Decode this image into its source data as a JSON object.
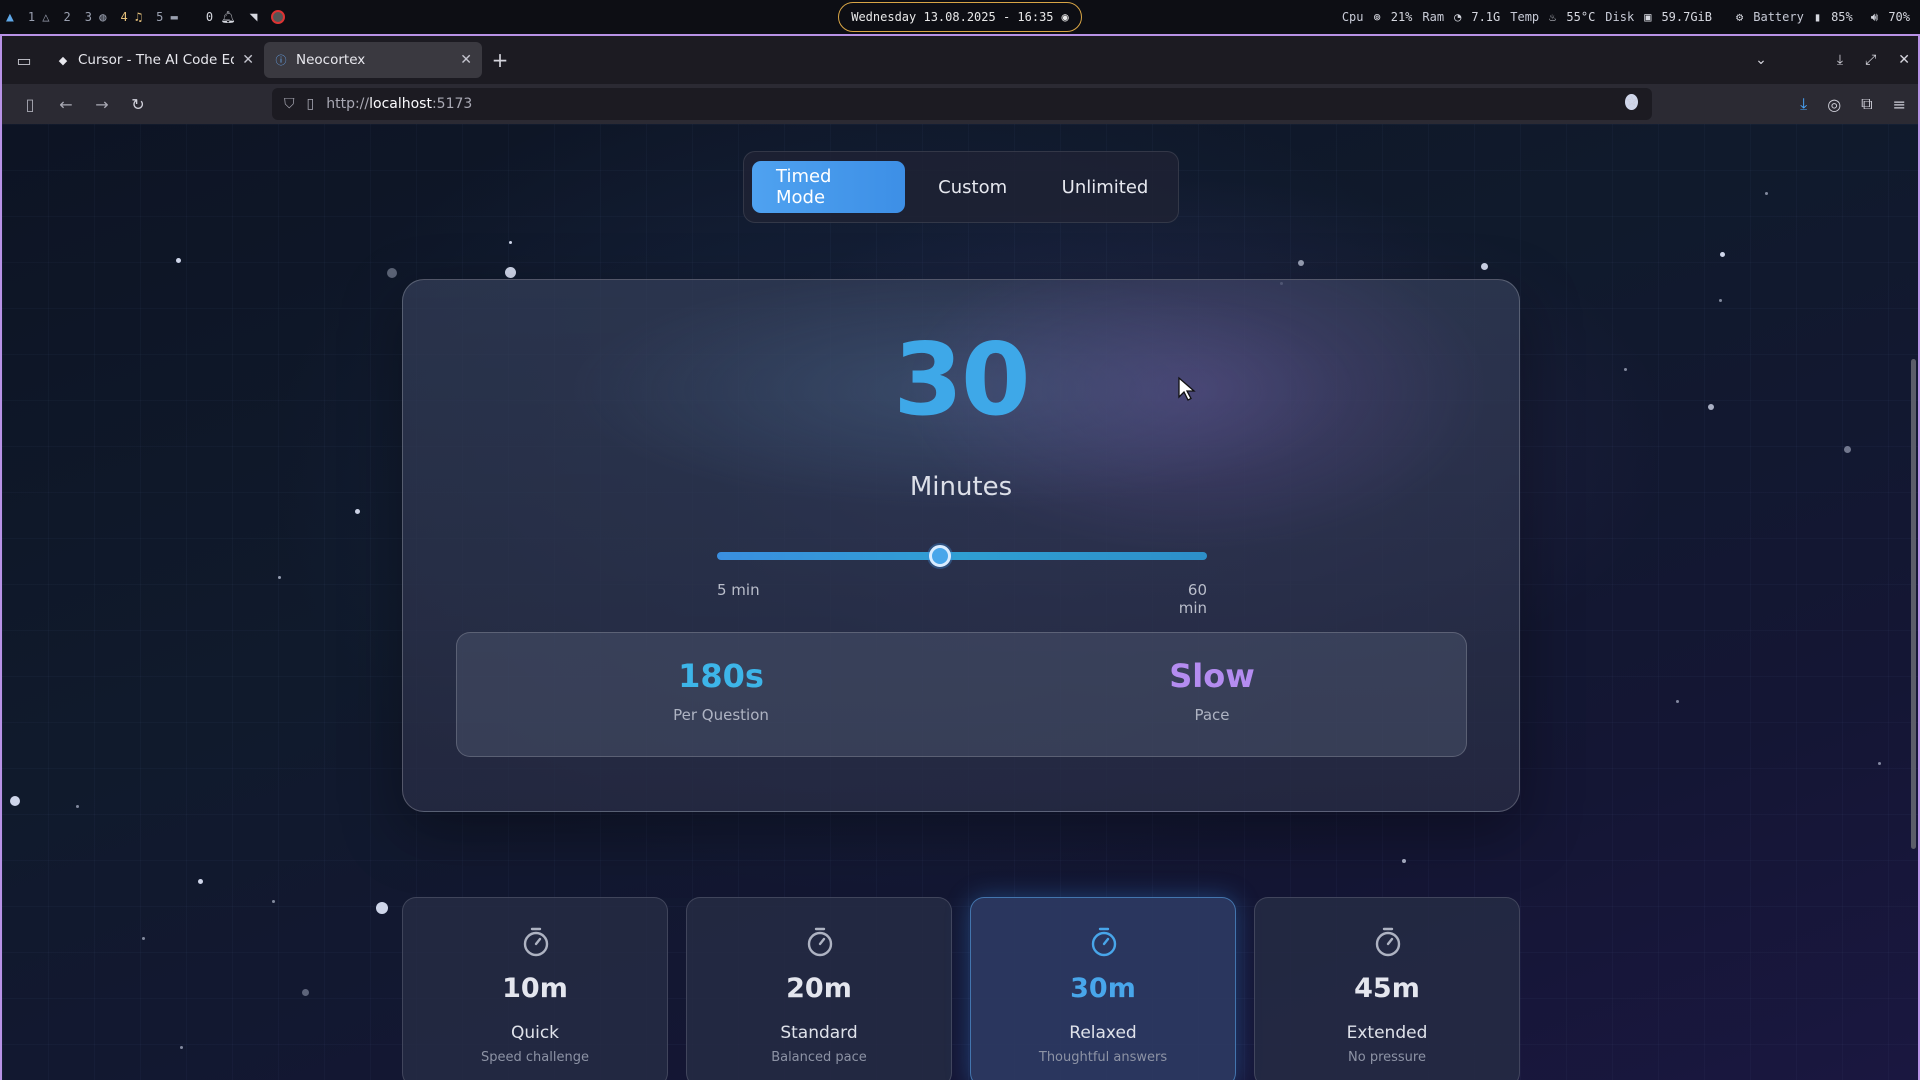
{
  "statusbar": {
    "workspaces": [
      {
        "num": "1",
        "icon": "warning-icon"
      },
      {
        "num": "2",
        "icon": ""
      },
      {
        "num": "3",
        "icon": "globe-icon"
      },
      {
        "num": "4",
        "icon": "music-icon"
      },
      {
        "num": "5",
        "icon": "folder-icon"
      }
    ],
    "notifications": "0",
    "clock": "Wednesday 13.08.2025 - 16:35",
    "cpu_label": "Cpu",
    "cpu_value": "21%",
    "ram_label": "Ram",
    "ram_value": "7.1G",
    "temp_label": "Temp",
    "temp_value": "55°C",
    "disk_label": "Disk",
    "disk_value": "59.7GiB",
    "battery_label": "Battery",
    "battery_value": "85%",
    "volume_value": "70%"
  },
  "browser": {
    "tabs": [
      {
        "title": "Cursor - The AI Code Editor",
        "active": false
      },
      {
        "title": "Neocortex",
        "active": true
      }
    ],
    "url_prefix": "http://",
    "url_host": "localhost",
    "url_suffix": ":5173"
  },
  "page": {
    "modes": [
      "Timed Mode",
      "Custom",
      "Unlimited"
    ],
    "active_mode": "Timed Mode",
    "duration_value": "30",
    "duration_unit": "Minutes",
    "slider": {
      "min": 5,
      "max": 60,
      "value": 30,
      "min_label": "5 min",
      "max_label": "60 min"
    },
    "stats": [
      {
        "value": "180s",
        "label": "Per Question",
        "color": "#3db5e8"
      },
      {
        "value": "Slow",
        "label": "Pace",
        "color": "#b48cf0"
      }
    ],
    "presets": [
      {
        "value": "10m",
        "name": "Quick",
        "desc": "Speed challenge",
        "icon": "stopwatch-icon",
        "selected": false
      },
      {
        "value": "20m",
        "name": "Standard",
        "desc": "Balanced pace",
        "icon": "stopwatch-icon",
        "selected": false
      },
      {
        "value": "30m",
        "name": "Relaxed",
        "desc": "Thoughtful answers",
        "icon": "stopwatch-icon",
        "selected": true
      },
      {
        "value": "45m",
        "name": "Extended",
        "desc": "No pressure",
        "icon": "stopwatch-icon",
        "selected": false
      }
    ]
  },
  "colors": {
    "accent": "#48a6ea",
    "window_border": "#b892e6",
    "clock_border": "#d8a545"
  }
}
